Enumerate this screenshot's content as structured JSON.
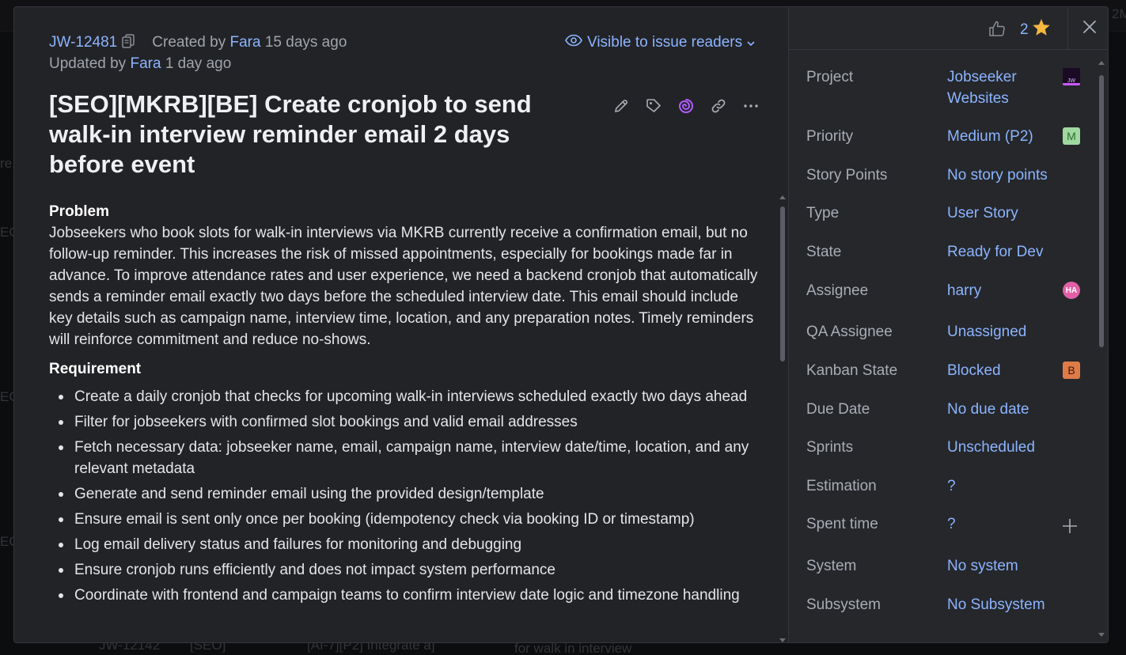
{
  "background": {
    "fragments": [
      "2M",
      "EO",
      "re.",
      "EO",
      "EO",
      "JW-12142",
      "[SEO]",
      "[AI-7][P2] Integrate a]",
      "for walk in interview"
    ]
  },
  "issue": {
    "id": "JW-12481",
    "created_prefix": "Created by",
    "created_by": "Fara",
    "created_ago": "15 days ago",
    "updated_prefix": "Updated by",
    "updated_by": "Fara",
    "updated_ago": "1 day ago",
    "visibility": "Visible to issue readers",
    "title": "[SEO][MKRB][BE] Create cronjob to send walk-in interview reminder email 2 days before event"
  },
  "description": {
    "problem_heading": "Problem",
    "problem_text": "Jobseekers who book slots for walk-in interviews via MKRB currently receive a confirmation email, but no follow-up reminder. This increases the risk of missed appointments, especially for bookings made far in advance. To improve attendance rates and user experience, we need a backend cronjob that automatically sends a reminder email exactly two days before the scheduled interview date. This email should include key details such as campaign name, interview time, location, and any preparation notes. Timely reminders will reinforce commitment and reduce no-shows.",
    "requirement_heading": "Requirement",
    "requirements": [
      "Create a daily cronjob that checks for upcoming walk-in interviews scheduled exactly two days ahead",
      "Filter for jobseekers with confirmed slot bookings and valid email addresses",
      "Fetch necessary data: jobseeker name, email, campaign name, interview date/time, location, and any relevant metadata",
      "Generate and send reminder email using the provided design/template",
      "Ensure email is sent only once per booking (idempotency check via booking ID or timestamp)",
      "Log email delivery status and failures for monitoring and debugging",
      "Ensure cronjob runs efficiently and does not impact system performance",
      "Coordinate with frontend and campaign teams to confirm interview date logic and timezone handling"
    ]
  },
  "sidebar": {
    "votes": "2",
    "fields": [
      {
        "label": "Project",
        "value": "Jobseeker Websites",
        "badge": "JW"
      },
      {
        "label": "Priority",
        "value": "Medium (P2)",
        "badge": "M"
      },
      {
        "label": "Story Points",
        "value": "No story points"
      },
      {
        "label": "Type",
        "value": "User Story"
      },
      {
        "label": "State",
        "value": "Ready for Dev"
      },
      {
        "label": "Assignee",
        "value": "harry",
        "badge": "HA"
      },
      {
        "label": "QA Assignee",
        "value": "Unassigned"
      },
      {
        "label": "Kanban State",
        "value": "Blocked",
        "badge": "B"
      },
      {
        "label": "Due Date",
        "value": "No due date"
      },
      {
        "label": "Sprints",
        "value": "Unscheduled"
      },
      {
        "label": "Estimation",
        "value": "?"
      },
      {
        "label": "Spent time",
        "value": "?"
      },
      {
        "label": "System",
        "value": "No system"
      },
      {
        "label": "Subsystem",
        "value": "No Subsystem"
      }
    ]
  },
  "colors": {
    "link": "#8cb4ff",
    "star": "#f4b93e",
    "ai_icon": "#b05cff"
  }
}
